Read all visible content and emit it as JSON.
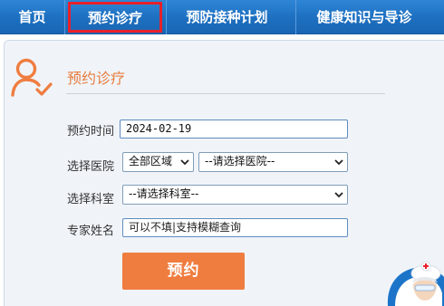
{
  "nav": {
    "home": "首页",
    "appointment": "预约诊疗",
    "vaccination": "预防接种计划",
    "health": "健康知识与导诊"
  },
  "card": {
    "title": "预约诊疗"
  },
  "form": {
    "time_label": "预约时间",
    "time_value": "2024-02-19",
    "hospital_label": "选择医院",
    "region_value": "全部区域",
    "hospital_value": "--请选择医院--",
    "department_label": "选择科室",
    "department_value": "--请选择科室--",
    "expert_label": "专家姓名",
    "expert_placeholder": "可以不填|支持模糊查询",
    "submit_label": "预约"
  },
  "colors": {
    "nav_bg": "#1d6fc0",
    "active_border": "#e8212a",
    "accent": "#ef7d40",
    "panel_bg": "#f0f4f9"
  },
  "icons": {
    "user_check": "user-check-icon",
    "select_arrow": "chevron-down-icon",
    "doctor": "doctor-illustration"
  }
}
